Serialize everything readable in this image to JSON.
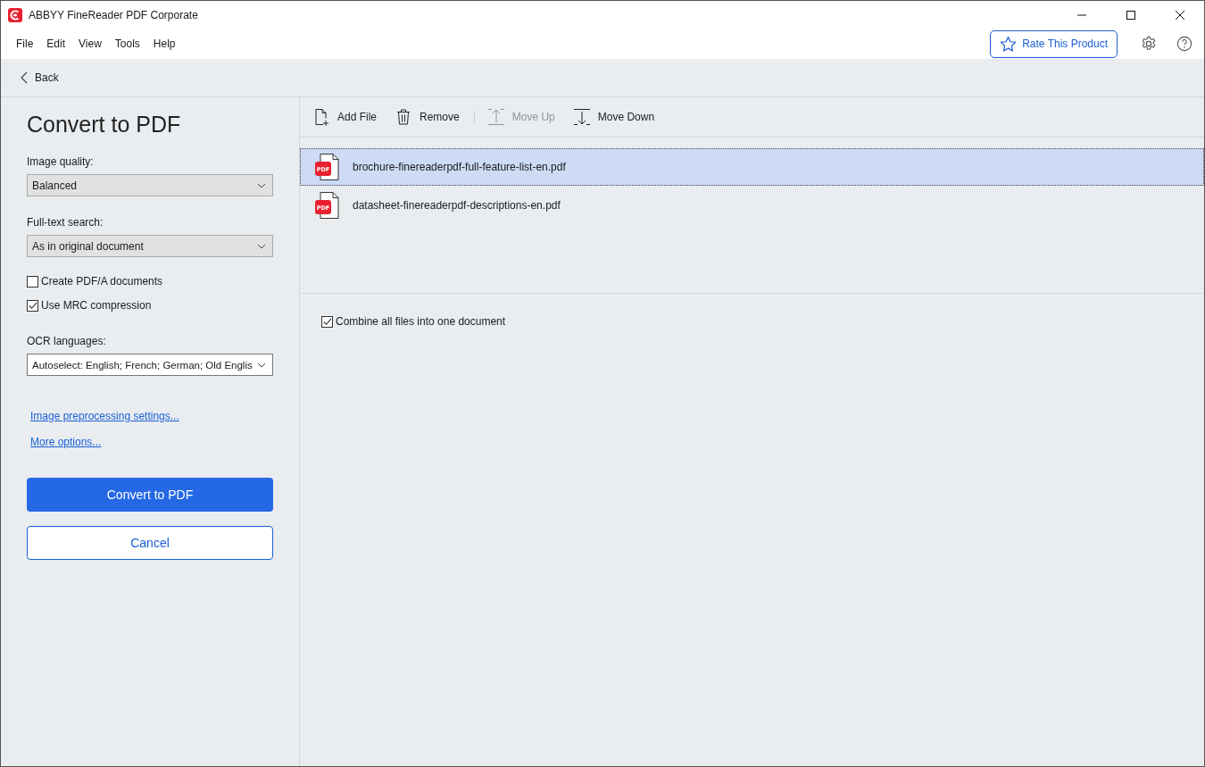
{
  "window": {
    "title": "ABBYY FineReader PDF Corporate"
  },
  "menu": [
    "File",
    "Edit",
    "View",
    "Tools",
    "Help"
  ],
  "rate_button": "Rate This Product",
  "back": "Back",
  "panel": {
    "title": "Convert to PDF",
    "fields": [
      {
        "label": "Image quality:",
        "value": "Balanced",
        "kind": "select"
      },
      {
        "label": "Full-text search:",
        "value": "As in original document",
        "kind": "select"
      }
    ],
    "checkboxes": [
      {
        "label": "Create PDF/A documents",
        "checked": false
      },
      {
        "label": "Use MRC compression",
        "checked": true
      }
    ],
    "ocr": {
      "label": "OCR languages:",
      "value": "Autoselect: English; French; German; Old Englis"
    },
    "links": [
      "Image preprocessing settings...",
      "More options..."
    ],
    "convert_button": "Convert to PDF",
    "cancel_button": "Cancel"
  },
  "toolbar": [
    {
      "label": "Add File",
      "kind": "add",
      "disabled": false
    },
    {
      "label": "Remove",
      "kind": "remove",
      "disabled": false
    },
    {
      "label": "Move Up",
      "kind": "up",
      "disabled": true
    },
    {
      "label": "Move Down",
      "kind": "down",
      "disabled": false
    }
  ],
  "files": [
    {
      "name": "brochure-finereaderpdf-full-feature-list-en.pdf",
      "badge": "PDF",
      "selected": true
    },
    {
      "name": "datasheet-finereaderpdf-descriptions-en.pdf",
      "badge": "PDF",
      "selected": false
    }
  ],
  "combine": {
    "label": "Combine all files into one document",
    "checked": true
  }
}
